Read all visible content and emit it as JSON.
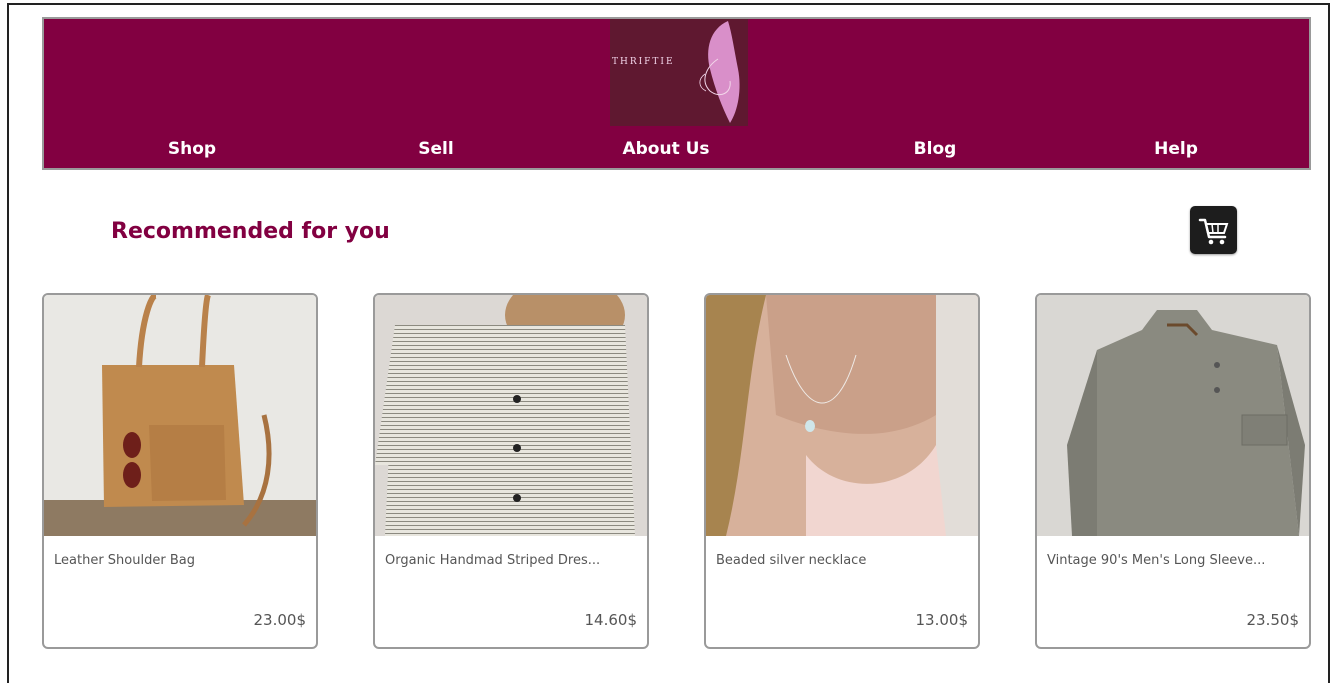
{
  "brand": {
    "logo_text": "THRIFTIE"
  },
  "nav": {
    "items": [
      {
        "label": "Shop"
      },
      {
        "label": "Sell"
      },
      {
        "label": "About Us"
      },
      {
        "label": "Blog"
      },
      {
        "label": "Help"
      }
    ]
  },
  "main": {
    "section_title": "Recommended for you",
    "products": [
      {
        "name": "Leather Shoulder Bag",
        "price": "23.00$"
      },
      {
        "name": "Organic Handmad Striped Dres...",
        "price": "14.60$"
      },
      {
        "name": "Beaded silver necklace",
        "price": "13.00$"
      },
      {
        "name": "Vintage 90's Men's Long Sleeve...",
        "price": "23.50$"
      }
    ]
  },
  "icons": {
    "cart": "shopping-cart-icon"
  },
  "colors": {
    "brand": "#820041",
    "logo_bg": "#5f1830",
    "logo_accent": "#d98fc9"
  }
}
